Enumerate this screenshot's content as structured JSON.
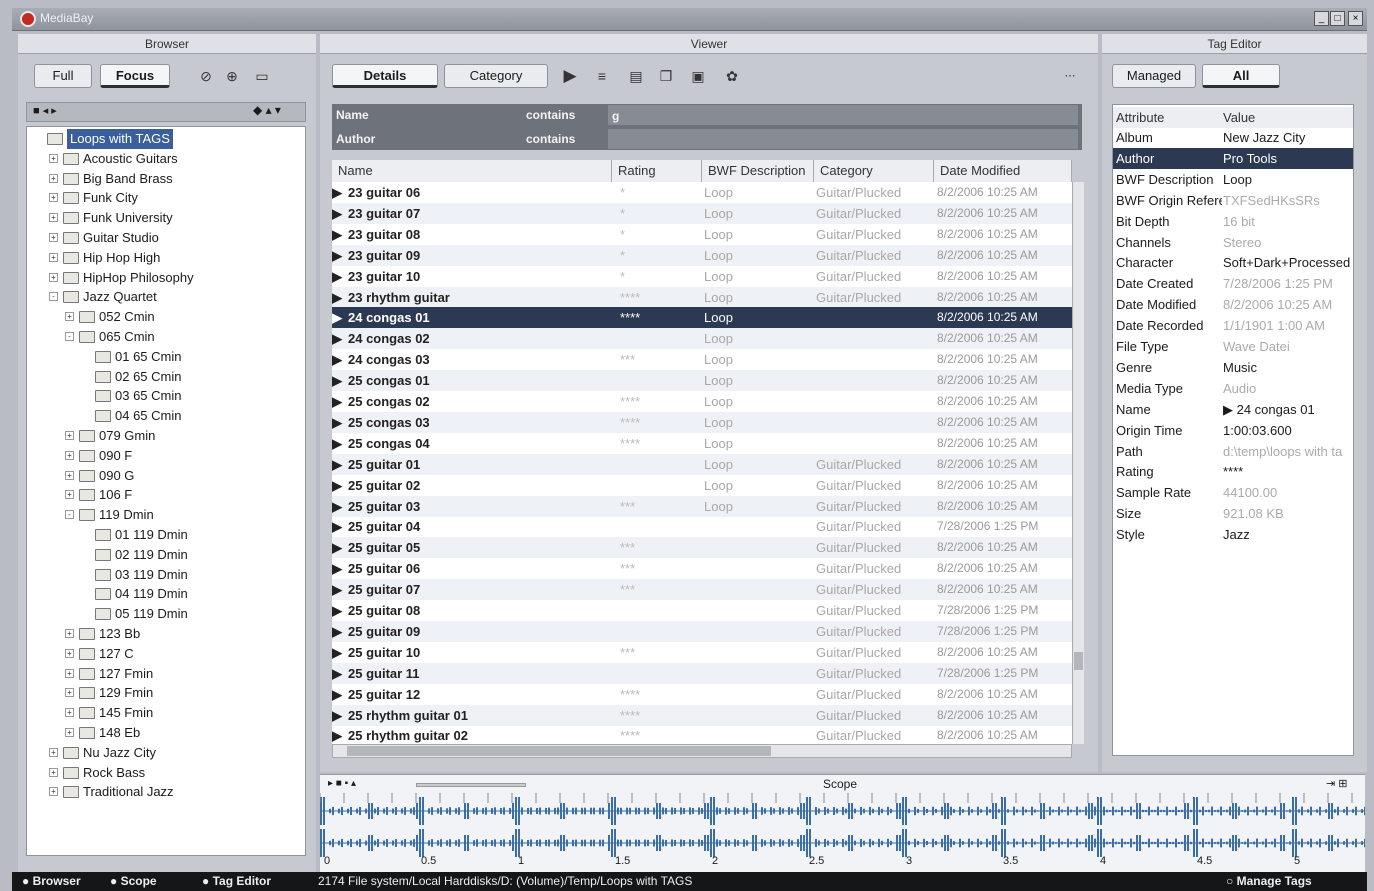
{
  "window": {
    "title": "MediaBay",
    "min": "_",
    "max": "□",
    "close": "×"
  },
  "browser": {
    "header": "Browser",
    "tabs": {
      "full": "Full",
      "focus": "Focus"
    },
    "tree": [
      {
        "label": "Loops with TAGS",
        "level": 0,
        "exp": "",
        "sel": true
      },
      {
        "label": "Acoustic Guitars",
        "level": 1,
        "exp": "+"
      },
      {
        "label": "Big Band Brass",
        "level": 1,
        "exp": "+"
      },
      {
        "label": "Funk City",
        "level": 1,
        "exp": "+"
      },
      {
        "label": "Funk University",
        "level": 1,
        "exp": "+"
      },
      {
        "label": "Guitar Studio",
        "level": 1,
        "exp": "+"
      },
      {
        "label": "Hip Hop High",
        "level": 1,
        "exp": "+"
      },
      {
        "label": "HipHop Philosophy",
        "level": 1,
        "exp": "+"
      },
      {
        "label": "Jazz Quartet",
        "level": 1,
        "exp": "-"
      },
      {
        "label": "052 Cmin",
        "level": 2,
        "exp": "+"
      },
      {
        "label": "065 Cmin",
        "level": 2,
        "exp": "-"
      },
      {
        "label": "01 65 Cmin",
        "level": 3,
        "exp": ""
      },
      {
        "label": "02 65 Cmin",
        "level": 3,
        "exp": ""
      },
      {
        "label": "03 65 Cmin",
        "level": 3,
        "exp": ""
      },
      {
        "label": "04 65 Cmin",
        "level": 3,
        "exp": ""
      },
      {
        "label": "079 Gmin",
        "level": 2,
        "exp": "+"
      },
      {
        "label": "090 F",
        "level": 2,
        "exp": "+"
      },
      {
        "label": "090 G",
        "level": 2,
        "exp": "+"
      },
      {
        "label": "106 F",
        "level": 2,
        "exp": "+"
      },
      {
        "label": "119 Dmin",
        "level": 2,
        "exp": "-"
      },
      {
        "label": "01 119 Dmin",
        "level": 3,
        "exp": ""
      },
      {
        "label": "02 119 Dmin",
        "level": 3,
        "exp": ""
      },
      {
        "label": "03 119 Dmin",
        "level": 3,
        "exp": ""
      },
      {
        "label": "04 119 Dmin",
        "level": 3,
        "exp": ""
      },
      {
        "label": "05 119 Dmin",
        "level": 3,
        "exp": ""
      },
      {
        "label": "123 Bb",
        "level": 2,
        "exp": "+"
      },
      {
        "label": "127 C",
        "level": 2,
        "exp": "+"
      },
      {
        "label": "127 Fmin",
        "level": 2,
        "exp": "+"
      },
      {
        "label": "129 Fmin",
        "level": 2,
        "exp": "+"
      },
      {
        "label": "145 Fmin",
        "level": 2,
        "exp": "+"
      },
      {
        "label": "148 Eb",
        "level": 2,
        "exp": "+"
      },
      {
        "label": "Nu Jazz City",
        "level": 1,
        "exp": "+"
      },
      {
        "label": "Rock Bass",
        "level": 1,
        "exp": "+"
      },
      {
        "label": "Traditional Jazz",
        "level": 1,
        "exp": "+"
      }
    ]
  },
  "viewer": {
    "header": "Viewer",
    "tabs": {
      "details": "Details",
      "category": "Category"
    },
    "filters": [
      {
        "field": "Name",
        "op": "contains",
        "value": "g"
      },
      {
        "field": "Author",
        "op": "contains",
        "value": ""
      }
    ],
    "columns": [
      "Name",
      "Rating",
      "BWF Description",
      "Category",
      "Date Modified"
    ],
    "rows": [
      {
        "name": "23 guitar 06",
        "rating": "*",
        "desc": "Loop",
        "cat": "Guitar/Plucked",
        "date": "8/2/2006 10:25 AM"
      },
      {
        "name": "23 guitar 07",
        "rating": "*",
        "desc": "Loop",
        "cat": "Guitar/Plucked",
        "date": "8/2/2006 10:25 AM"
      },
      {
        "name": "23 guitar 08",
        "rating": "*",
        "desc": "Loop",
        "cat": "Guitar/Plucked",
        "date": "8/2/2006 10:25 AM"
      },
      {
        "name": "23 guitar 09",
        "rating": "*",
        "desc": "Loop",
        "cat": "Guitar/Plucked",
        "date": "8/2/2006 10:25 AM"
      },
      {
        "name": "23 guitar 10",
        "rating": "*",
        "desc": "Loop",
        "cat": "Guitar/Plucked",
        "date": "8/2/2006 10:25 AM"
      },
      {
        "name": "23 rhythm guitar",
        "rating": "****",
        "desc": "Loop",
        "cat": "Guitar/Plucked",
        "date": "8/2/2006 10:25 AM"
      },
      {
        "name": "24 congas 01",
        "rating": "****",
        "desc": "Loop",
        "cat": "",
        "date": "8/2/2006 10:25 AM",
        "sel": true
      },
      {
        "name": "24 congas 02",
        "rating": "",
        "desc": "Loop",
        "cat": "",
        "date": "8/2/2006 10:25 AM"
      },
      {
        "name": "24 congas 03",
        "rating": "***",
        "desc": "Loop",
        "cat": "",
        "date": "8/2/2006 10:25 AM"
      },
      {
        "name": "25 congas 01",
        "rating": "",
        "desc": "Loop",
        "cat": "",
        "date": "8/2/2006 10:25 AM"
      },
      {
        "name": "25 congas 02",
        "rating": "****",
        "desc": "Loop",
        "cat": "",
        "date": "8/2/2006 10:25 AM"
      },
      {
        "name": "25 congas 03",
        "rating": "****",
        "desc": "Loop",
        "cat": "",
        "date": "8/2/2006 10:25 AM"
      },
      {
        "name": "25 congas 04",
        "rating": "****",
        "desc": "Loop",
        "cat": "",
        "date": "8/2/2006 10:25 AM"
      },
      {
        "name": "25 guitar 01",
        "rating": "",
        "desc": "Loop",
        "cat": "Guitar/Plucked",
        "date": "8/2/2006 10:25 AM"
      },
      {
        "name": "25 guitar 02",
        "rating": "",
        "desc": "Loop",
        "cat": "Guitar/Plucked",
        "date": "8/2/2006 10:25 AM"
      },
      {
        "name": "25 guitar 03",
        "rating": "***",
        "desc": "Loop",
        "cat": "Guitar/Plucked",
        "date": "8/2/2006 10:25 AM"
      },
      {
        "name": "25 guitar 04",
        "rating": "",
        "desc": "",
        "cat": "Guitar/Plucked",
        "date": "7/28/2006 1:25 PM"
      },
      {
        "name": "25 guitar 05",
        "rating": "***",
        "desc": "",
        "cat": "Guitar/Plucked",
        "date": "8/2/2006 10:25 AM"
      },
      {
        "name": "25 guitar 06",
        "rating": "***",
        "desc": "",
        "cat": "Guitar/Plucked",
        "date": "8/2/2006 10:25 AM"
      },
      {
        "name": "25 guitar 07",
        "rating": "***",
        "desc": "",
        "cat": "Guitar/Plucked",
        "date": "8/2/2006 10:25 AM"
      },
      {
        "name": "25 guitar 08",
        "rating": "",
        "desc": "",
        "cat": "Guitar/Plucked",
        "date": "7/28/2006 1:25 PM"
      },
      {
        "name": "25 guitar 09",
        "rating": "",
        "desc": "",
        "cat": "Guitar/Plucked",
        "date": "7/28/2006 1:25 PM"
      },
      {
        "name": "25 guitar 10",
        "rating": "***",
        "desc": "",
        "cat": "Guitar/Plucked",
        "date": "8/2/2006 10:25 AM"
      },
      {
        "name": "25 guitar 11",
        "rating": "",
        "desc": "",
        "cat": "Guitar/Plucked",
        "date": "7/28/2006 1:25 PM"
      },
      {
        "name": "25 guitar 12",
        "rating": "****",
        "desc": "",
        "cat": "Guitar/Plucked",
        "date": "8/2/2006 10:25 AM"
      },
      {
        "name": "25 rhythm guitar 01",
        "rating": "****",
        "desc": "",
        "cat": "Guitar/Plucked",
        "date": "8/2/2006 10:25 AM"
      },
      {
        "name": "25 rhythm guitar 02",
        "rating": "****",
        "desc": "",
        "cat": "Guitar/Plucked",
        "date": "8/2/2006 10:25 AM"
      }
    ]
  },
  "tag_editor": {
    "header": "Tag Editor",
    "tabs": {
      "managed": "Managed",
      "all": "All"
    },
    "columns": [
      "Attribute",
      "Value"
    ],
    "rows": [
      {
        "attr": "Album",
        "val": "New Jazz City"
      },
      {
        "attr": "Author",
        "val": "Pro Tools",
        "sel": true
      },
      {
        "attr": "BWF Description",
        "val": "Loop"
      },
      {
        "attr": "BWF Origin Reference",
        "val": "TXFSedHKsSRs",
        "dim": true
      },
      {
        "attr": "Bit Depth",
        "val": "16 bit",
        "dim": true
      },
      {
        "attr": "Channels",
        "val": "Stereo",
        "dim": true
      },
      {
        "attr": "Character",
        "val": "Soft+Dark+Processed"
      },
      {
        "attr": "Date Created",
        "val": "7/28/2006 1:25 PM",
        "dim": true
      },
      {
        "attr": "Date Modified",
        "val": "8/2/2006 10:25 AM",
        "dim": true
      },
      {
        "attr": "Date Recorded",
        "val": "1/1/1901 1:00 AM",
        "dim": true
      },
      {
        "attr": "File Type",
        "val": "Wave Datei",
        "dim": true
      },
      {
        "attr": "Genre",
        "val": "Music"
      },
      {
        "attr": "Media Type",
        "val": "Audio",
        "dim": true
      },
      {
        "attr": "Name",
        "val": "▶ 24 congas 01"
      },
      {
        "attr": "Origin Time",
        "val": "1:00:03.600"
      },
      {
        "attr": "Path",
        "val": "d:\\temp\\loops with ta",
        "dim": true
      },
      {
        "attr": "Rating",
        "val": "****"
      },
      {
        "attr": "Sample Rate",
        "val": "44100.00",
        "dim": true
      },
      {
        "attr": "Size",
        "val": "921.08 KB",
        "dim": true
      },
      {
        "attr": "Style",
        "val": "Jazz"
      }
    ]
  },
  "scope": {
    "label": "Scope",
    "ruler": [
      "0",
      "0.5",
      "1",
      "1.5",
      "2",
      "2.5",
      "3",
      "3.5",
      "4",
      "4.5",
      "5"
    ],
    "waveform_color": "#3a6ea5"
  },
  "statusbar": {
    "browser": "Browser",
    "scope": "Scope",
    "tag_editor": "Tag Editor",
    "info": "2174 File system/Local Harddisks/D: (Volume)/Temp/Loops with TAGS",
    "manage_tags": "Manage Tags"
  }
}
